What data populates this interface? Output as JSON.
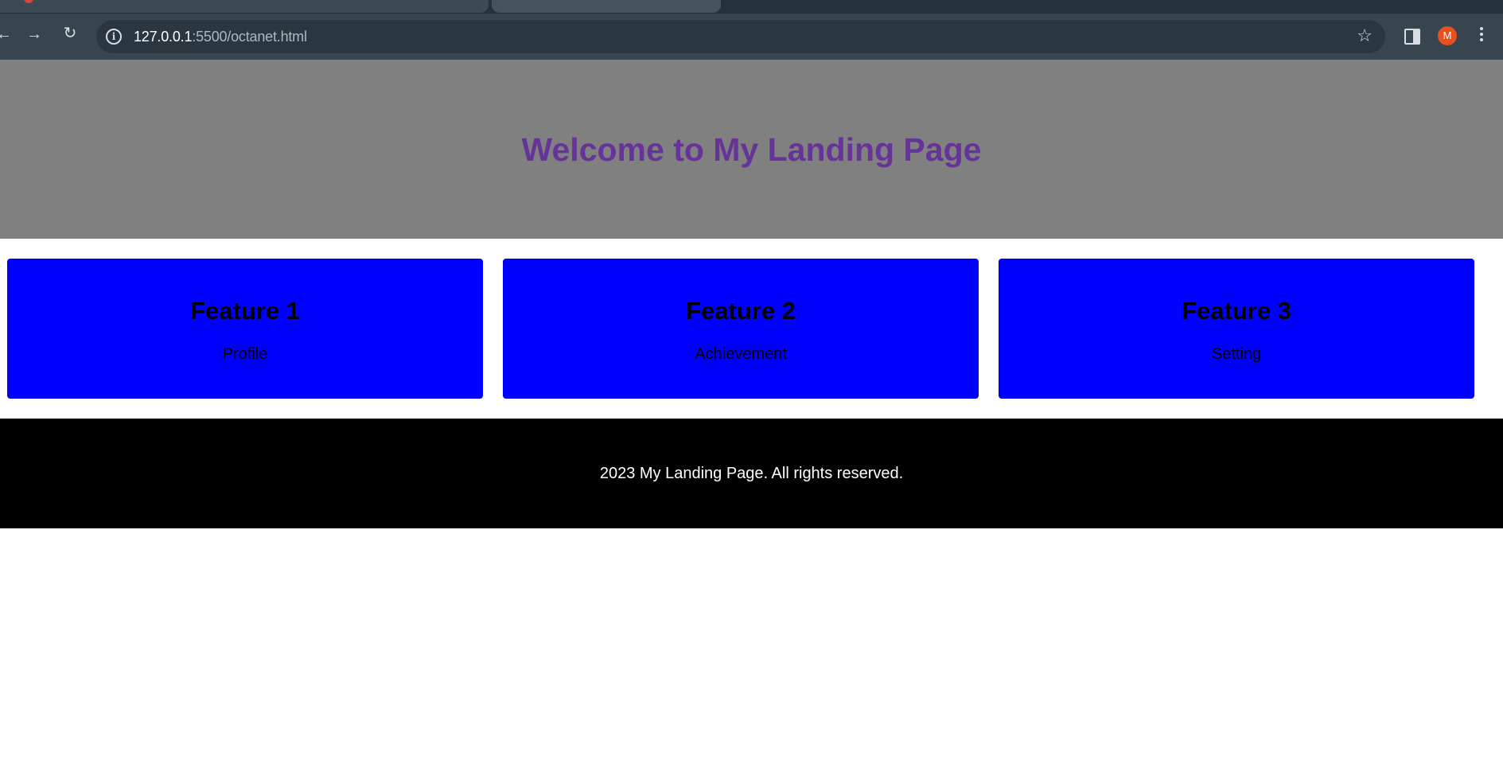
{
  "browser": {
    "url_host": "127.0.0.1",
    "url_path": ":5500/octanet.html",
    "avatar_initial": "M",
    "icons": [
      "back-icon",
      "forward-icon",
      "reload-icon",
      "site-info-icon",
      "bookmark-star-icon",
      "side-panel-icon",
      "menu-icon"
    ]
  },
  "hero": {
    "title": "Welcome to My Landing Page",
    "title_color": "#663399",
    "background": "#808080"
  },
  "features": [
    {
      "title": "Feature 1",
      "text": "Profile"
    },
    {
      "title": "Feature 2",
      "text": "Achievement"
    },
    {
      "title": "Feature 3",
      "text": "Setting"
    }
  ],
  "feature_card_color": "#0000ff",
  "footer": {
    "text": "2023 My Landing Page. All rights reserved.",
    "background": "#000000"
  }
}
